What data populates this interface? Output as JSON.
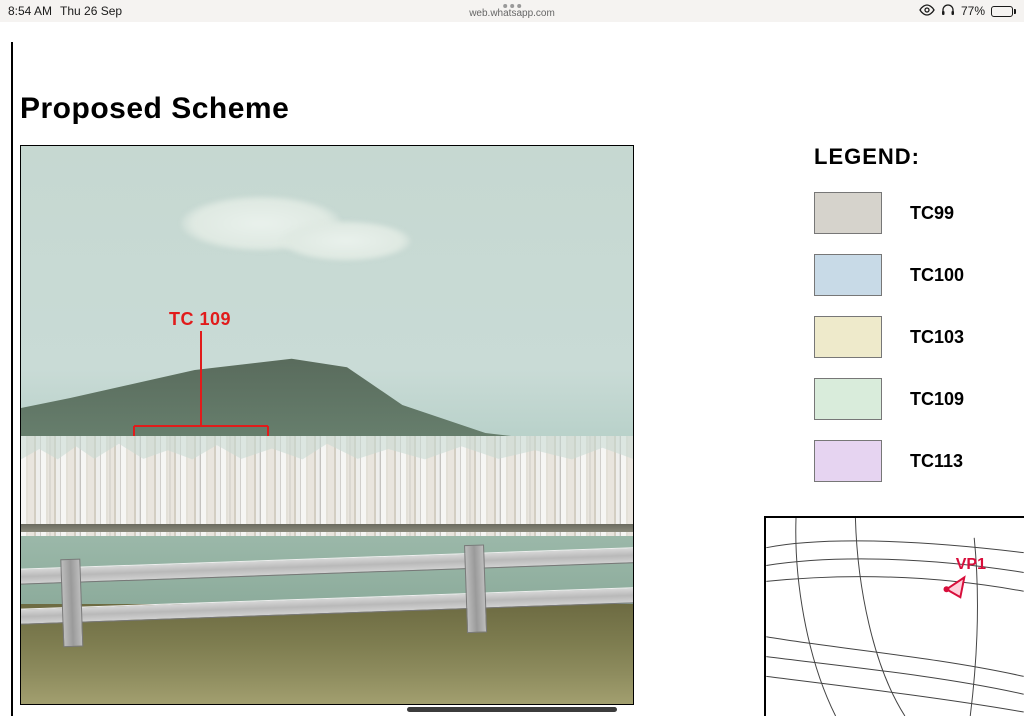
{
  "status": {
    "time": "8:54 AM",
    "date": "Thu 26 Sep",
    "url": "web.whatsapp.com",
    "battery_pct": "77%"
  },
  "doc": {
    "title": "Proposed  Scheme",
    "callout_label": "TC 109"
  },
  "legend": {
    "title": "LEGEND:",
    "items": [
      {
        "code": "TC99",
        "swatch": "c99"
      },
      {
        "code": "TC100",
        "swatch": "c100"
      },
      {
        "code": "TC103",
        "swatch": "c103"
      },
      {
        "code": "TC109",
        "swatch": "c109"
      },
      {
        "code": "TC113",
        "swatch": "c113"
      }
    ]
  },
  "minimap": {
    "viewpoint_label": "VP1"
  }
}
